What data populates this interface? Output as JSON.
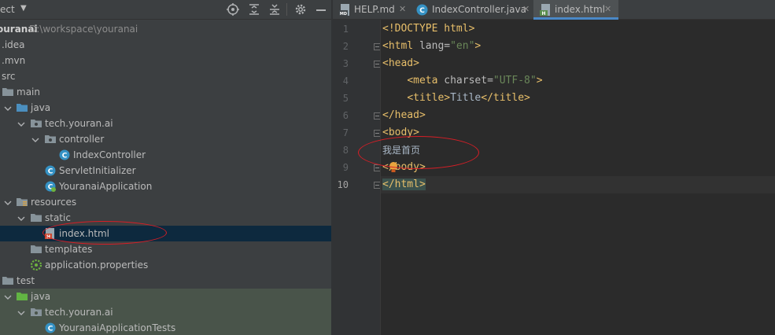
{
  "project_panel": {
    "title": "ect",
    "dropdown_icon": "caret-down-icon",
    "header_icons": [
      "locate-icon",
      "expand-all-icon",
      "collapse-all-icon",
      "gear-icon",
      "minimize-icon"
    ]
  },
  "tree": [
    {
      "label": "ouranai",
      "path": "D:\\workspace\\youranai"
    },
    {
      "label": ".idea"
    },
    {
      "label": ".mvn"
    },
    {
      "label": "src"
    },
    {
      "label": "main"
    },
    {
      "label": "java"
    },
    {
      "label": "tech.youran.ai"
    },
    {
      "label": "controller"
    },
    {
      "label": "IndexController"
    },
    {
      "label": "ServletInitializer"
    },
    {
      "label": "YouranaiApplication"
    },
    {
      "label": "resources"
    },
    {
      "label": "static"
    },
    {
      "label": "index.html"
    },
    {
      "label": "templates"
    },
    {
      "label": "application.properties"
    },
    {
      "label": "test"
    },
    {
      "label": "java"
    },
    {
      "label": "tech.youran.ai"
    },
    {
      "label": "YouranaiApplicationTests"
    }
  ],
  "tabs": [
    {
      "label": "HELP.md",
      "icon": "markdown-file-icon",
      "active": false
    },
    {
      "label": "IndexController.java",
      "icon": "java-class-icon",
      "active": false
    },
    {
      "label": "index.html",
      "icon": "html-file-icon",
      "active": true
    }
  ],
  "editor": {
    "line_numbers": [
      "1",
      "2",
      "3",
      "4",
      "5",
      "6",
      "7",
      "8",
      "9",
      "10"
    ],
    "current_line": "10",
    "code": {
      "doctype": "<!DOCTYPE html>",
      "html_open_tag": "<html",
      "html_attr": " lang=",
      "html_attr_value": "\"en\"",
      "html_open_close": ">",
      "head_open": "<head>",
      "meta_open": "<meta",
      "meta_attr": " charset=",
      "meta_attr_value": "\"UTF-8\"",
      "meta_close": ">",
      "title_open": "<title>",
      "title_text": "Title",
      "title_close": "</title>",
      "head_close": "</head>",
      "body_open": "<body>",
      "body_text": "我是首页",
      "body_close_a": "<",
      "body_close_b": "/body>",
      "html_close": "</html>"
    }
  },
  "colors": {
    "panel_bg": "#3c3f41",
    "editor_bg": "#2b2b2b",
    "selection": "#0d293e",
    "test_source_bg": "#49544a",
    "accent": "#4a88c7",
    "tag": "#e8bf6a",
    "string": "#6a8759",
    "annotation": "#d71e26"
  }
}
